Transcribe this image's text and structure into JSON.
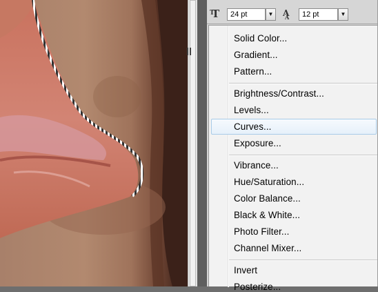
{
  "toolbar": {
    "font_size": "24 pt",
    "leading": "12 pt",
    "font_size_icon": "font-size-icon",
    "leading_icon": "leading-icon"
  },
  "menu": {
    "items": [
      {
        "label": "Solid Color..."
      },
      {
        "label": "Gradient..."
      },
      {
        "label": "Pattern..."
      },
      {
        "label": "Brightness/Contrast..."
      },
      {
        "label": "Levels..."
      },
      {
        "label": "Curves...",
        "highlighted": true
      },
      {
        "label": "Exposure..."
      },
      {
        "label": "Vibrance..."
      },
      {
        "label": "Hue/Saturation..."
      },
      {
        "label": "Color Balance..."
      },
      {
        "label": "Black & White..."
      },
      {
        "label": "Photo Filter..."
      },
      {
        "label": "Channel Mixer..."
      },
      {
        "label": "Invert"
      },
      {
        "label": "Posterize..."
      }
    ]
  },
  "colors": {
    "menu_bg": "#f2f2f2",
    "highlight_border": "#a8cbe8",
    "selection_marquee": "#ffffff"
  }
}
